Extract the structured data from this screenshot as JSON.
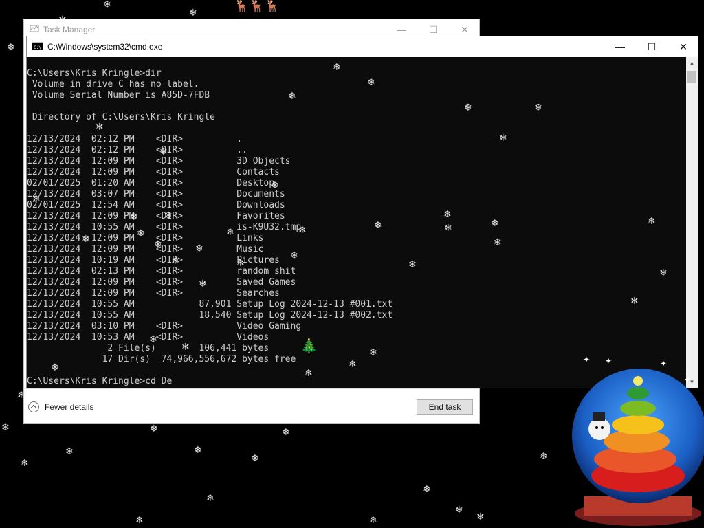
{
  "task_manager": {
    "title": "Task Manager",
    "minimize_icon": "minimize-icon",
    "maximize_icon": "maximize-icon",
    "close_icon": "close-icon",
    "fewer_details": "Fewer details",
    "end_task": "End task"
  },
  "cmd": {
    "title": "C:\\Windows\\system32\\cmd.exe",
    "lines": [
      "",
      "C:\\Users\\Kris Kringle>dir",
      " Volume in drive C has no label.",
      " Volume Serial Number is A85D-7FDB",
      "",
      " Directory of C:\\Users\\Kris Kringle",
      "",
      "12/13/2024  02:12 PM    <DIR>          .",
      "12/13/2024  02:12 PM    <DIR>          ..",
      "12/13/2024  12:09 PM    <DIR>          3D Objects",
      "12/13/2024  12:09 PM    <DIR>          Contacts",
      "02/01/2025  01:20 AM    <DIR>          Desktop",
      "12/13/2024  03:07 PM    <DIR>          Documents",
      "02/01/2025  12:54 AM    <DIR>          Downloads",
      "12/13/2024  12:09 PM    <DIR>          Favorites",
      "12/13/2024  10:55 AM    <DIR>          is-K9U32.tmp",
      "12/13/2024  12:09 PM    <DIR>          Links",
      "12/13/2024  12:09 PM    <DIR>          Music",
      "12/13/2024  10:19 AM    <DIR>          Pictures",
      "12/13/2024  02:13 PM    <DIR>          random shit",
      "12/13/2024  12:09 PM    <DIR>          Saved Games",
      "12/13/2024  12:09 PM    <DIR>          Searches",
      "12/13/2024  10:55 AM            87,901 Setup Log 2024-12-13 #001.txt",
      "12/13/2024  10:55 AM            18,540 Setup Log 2024-12-13 #002.txt",
      "12/13/2024  03:10 PM    <DIR>          Video Gaming",
      "12/13/2024  10:53 AM    <DIR>          Videos",
      "               2 File(s)        106,441 bytes",
      "              17 Dir(s)  74,966,556,672 bytes free",
      "",
      "C:\\Users\\Kris Kringle>cd De"
    ]
  },
  "colors": {
    "console_bg": "#0c0c0c",
    "console_text": "#cccccc",
    "desktop_bg": "#000000"
  }
}
